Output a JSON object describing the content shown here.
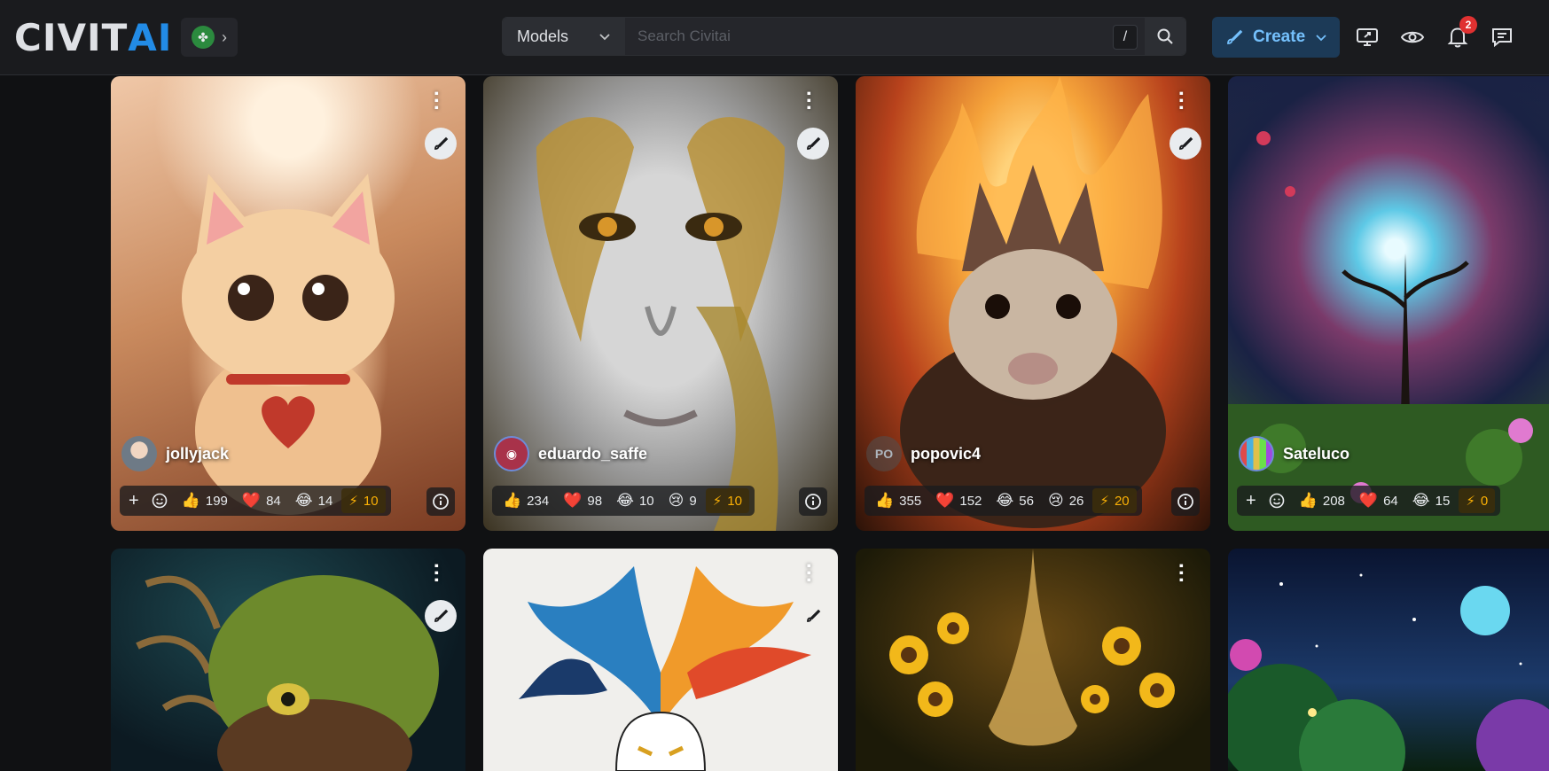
{
  "header": {
    "logo_civ": "CIVIT",
    "logo_ai": "AI",
    "search_type": "Models",
    "search_placeholder": "Search Civitai",
    "search_shortcut": "/",
    "create_label": "Create",
    "notifications_count": "2"
  },
  "cards": [
    {
      "user": "jollyjack",
      "avatar_text": "",
      "reactions": [
        {
          "emoji": "👍",
          "count": "199"
        },
        {
          "emoji": "❤️",
          "count": "84"
        },
        {
          "emoji": "😂",
          "count": "14"
        }
      ],
      "buzz": "10",
      "has_add": true,
      "colors": [
        "#f0c8a8",
        "#c98a5e",
        "#7a3b22"
      ]
    },
    {
      "user": "eduardo_saffe",
      "avatar_text": "",
      "reactions": [
        {
          "emoji": "👍",
          "count": "234"
        },
        {
          "emoji": "❤️",
          "count": "98"
        },
        {
          "emoji": "😂",
          "count": "10"
        },
        {
          "emoji": "😢",
          "count": "9"
        }
      ],
      "buzz": "10",
      "has_add": false,
      "colors": [
        "#bdbdbd",
        "#9a8e6c",
        "#3a3220"
      ]
    },
    {
      "user": "popovic4",
      "avatar_text": "PO",
      "reactions": [
        {
          "emoji": "👍",
          "count": "355"
        },
        {
          "emoji": "❤️",
          "count": "152"
        },
        {
          "emoji": "😂",
          "count": "56"
        },
        {
          "emoji": "😢",
          "count": "26"
        }
      ],
      "buzz": "20",
      "has_add": false,
      "colors": [
        "#f5a33a",
        "#b8421c",
        "#2a1208"
      ]
    },
    {
      "user": "Sateluco",
      "avatar_text": "",
      "reactions": [
        {
          "emoji": "👍",
          "count": "208"
        },
        {
          "emoji": "❤️",
          "count": "64"
        },
        {
          "emoji": "😂",
          "count": "15"
        }
      ],
      "buzz": "0",
      "has_add": true,
      "colors": [
        "#5ec9e6",
        "#7a3a6a",
        "#1c3a1c"
      ]
    },
    {
      "user": "",
      "colors": [
        "#6d8a2c",
        "#2f3a1a",
        "#0c1a22"
      ]
    },
    {
      "user": "",
      "colors": [
        "#f4f4f2",
        "#e8a040",
        "#2a6fb0"
      ]
    },
    {
      "user": "",
      "colors": [
        "#e0a830",
        "#5a3e10",
        "#1c1a08"
      ]
    },
    {
      "user": "",
      "colors": [
        "#1c3a6a",
        "#0a1430",
        "#3a1a5a"
      ]
    }
  ]
}
